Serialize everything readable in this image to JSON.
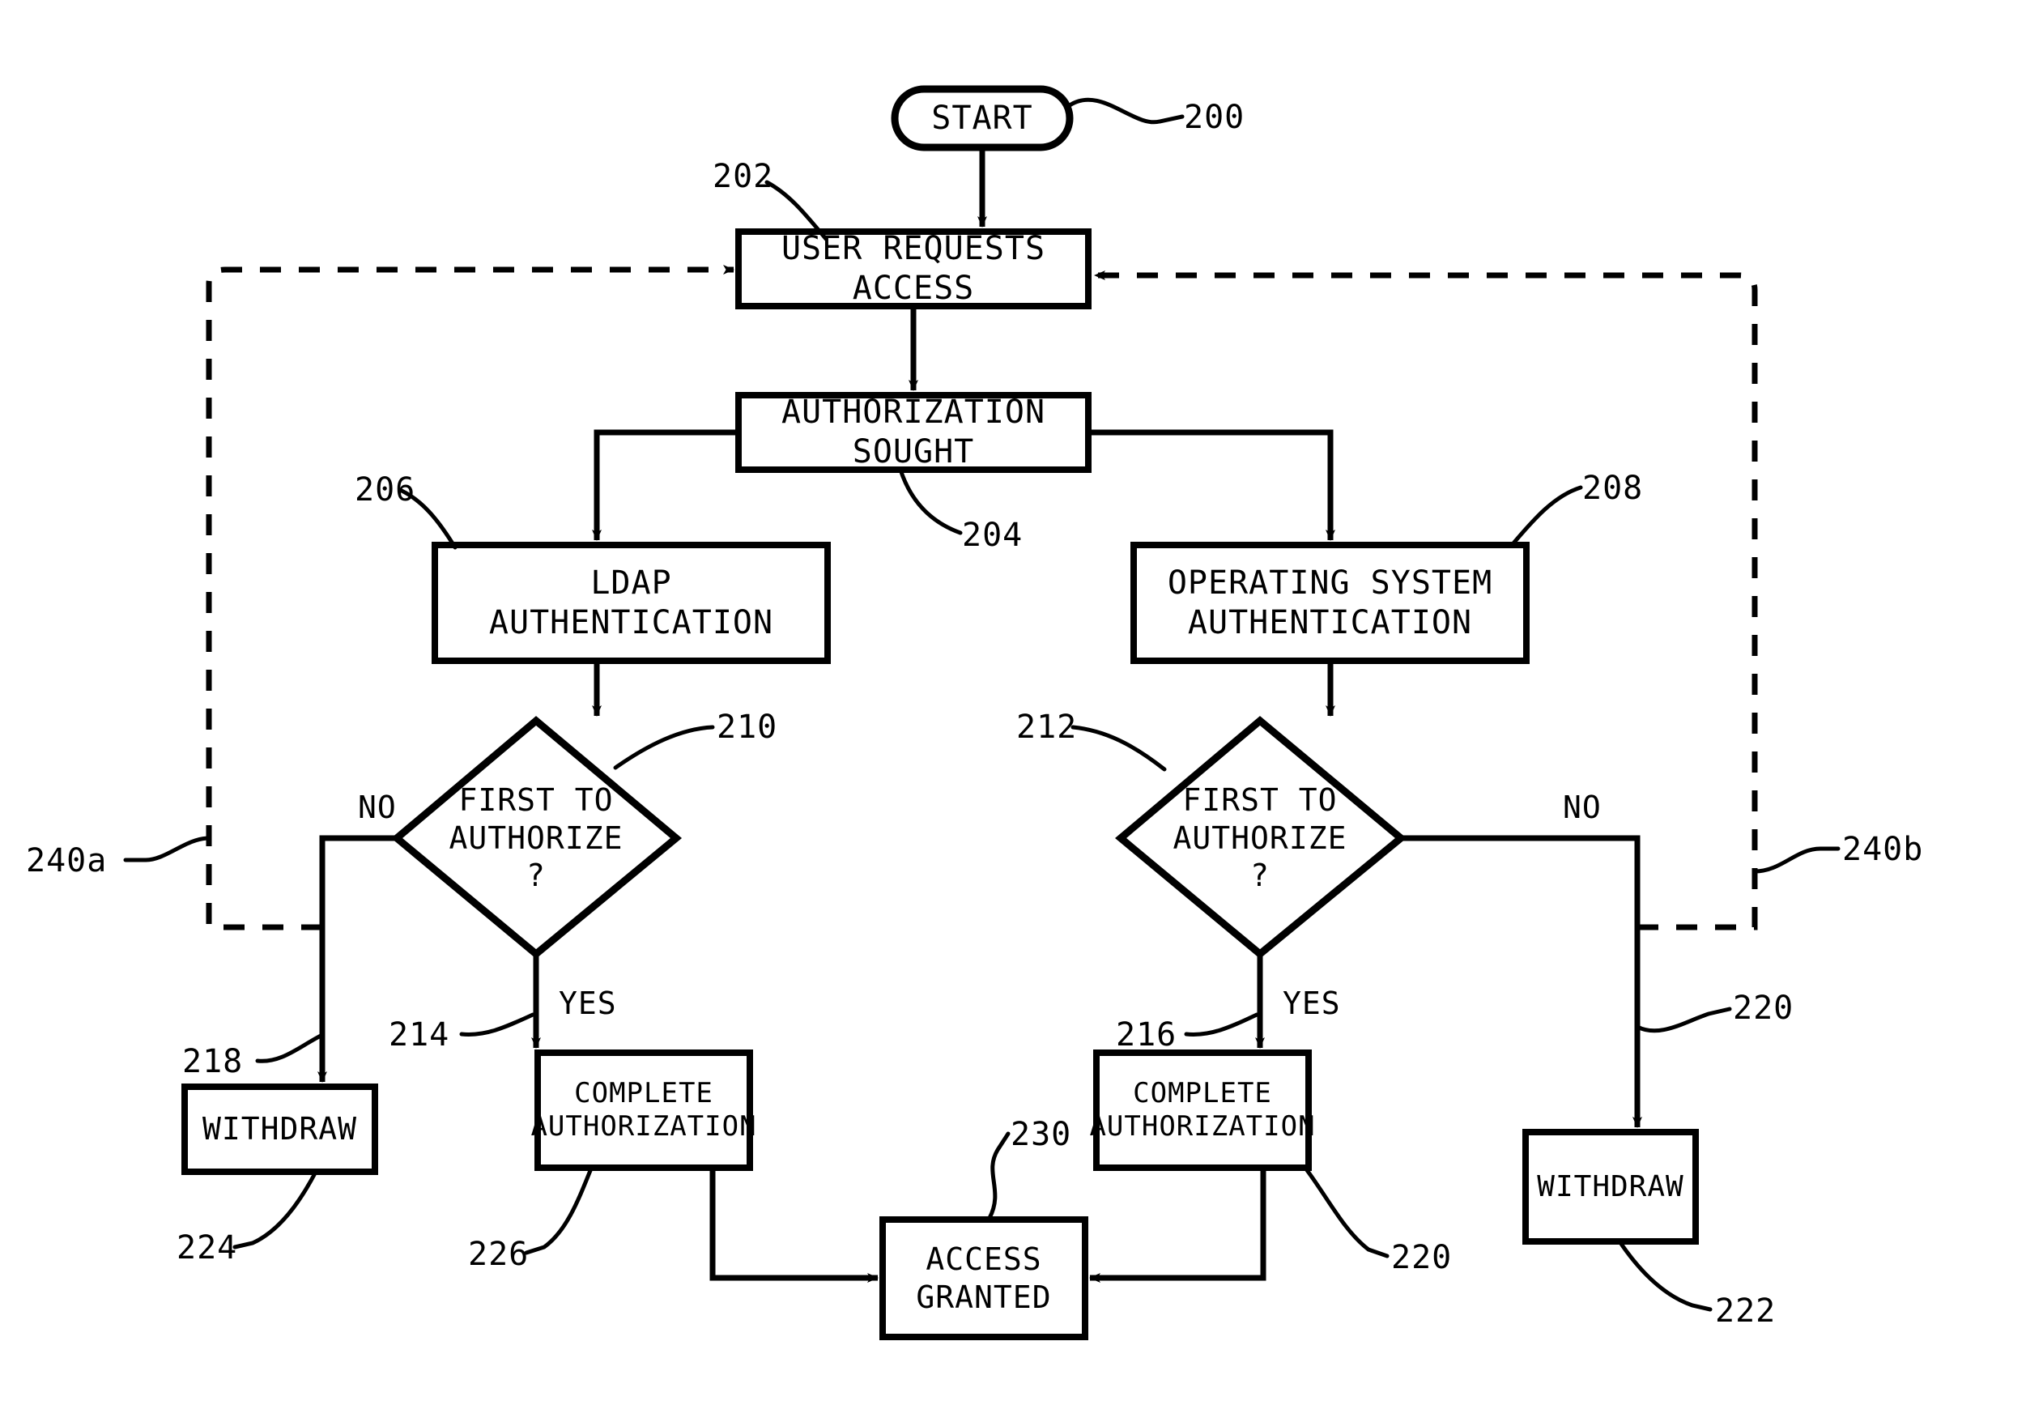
{
  "figure": {
    "type": "patent-flowchart",
    "background_color": "#ffffff",
    "stroke_color": "#000000"
  },
  "nodes": {
    "start": {
      "label": "START",
      "shape": "stadium"
    },
    "user_requests_access": {
      "label": "USER REQUESTS ACCESS",
      "shape": "rect"
    },
    "authorization_sought": {
      "label": "AUTHORIZATION SOUGHT",
      "shape": "rect"
    },
    "ldap_authentication": {
      "label": "LDAP\nAUTHENTICATION",
      "shape": "rect"
    },
    "os_authentication": {
      "label": "OPERATING SYSTEM\nAUTHENTICATION",
      "shape": "rect"
    },
    "decision_left": {
      "label": "FIRST TO\nAUTHORIZE\n?",
      "shape": "diamond"
    },
    "decision_right": {
      "label": "FIRST TO\nAUTHORIZE\n?",
      "shape": "diamond"
    },
    "withdraw_left": {
      "label": "WITHDRAW",
      "shape": "rect"
    },
    "withdraw_right": {
      "label": "WITHDRAW",
      "shape": "rect"
    },
    "complete_auth_left": {
      "label": "COMPLETE\nAUTHORIZATION",
      "shape": "rect"
    },
    "complete_auth_right": {
      "label": "COMPLETE\nAUTHORIZATION",
      "shape": "rect"
    },
    "access_granted": {
      "label": "ACCESS\nGRANTED",
      "shape": "rect"
    }
  },
  "edge_labels": {
    "no_left": "NO",
    "no_right": "NO",
    "yes_left": "YES",
    "yes_right": "YES"
  },
  "reference_numerals": {
    "start": "200",
    "user_requests_access": "202",
    "authorization_sought": "204",
    "ldap_authentication": "206",
    "os_authentication": "208",
    "decision_left": "210",
    "decision_right": "212",
    "yes_left_branch": "214",
    "yes_right_branch": "216",
    "no_left_branch": "218",
    "no_right_branch": "220",
    "complete_auth_right_out": "220",
    "withdraw_right": "222",
    "withdraw_left": "224",
    "complete_auth_left_out": "226",
    "access_granted": "230",
    "loop_left": "240a",
    "loop_right": "240b"
  }
}
